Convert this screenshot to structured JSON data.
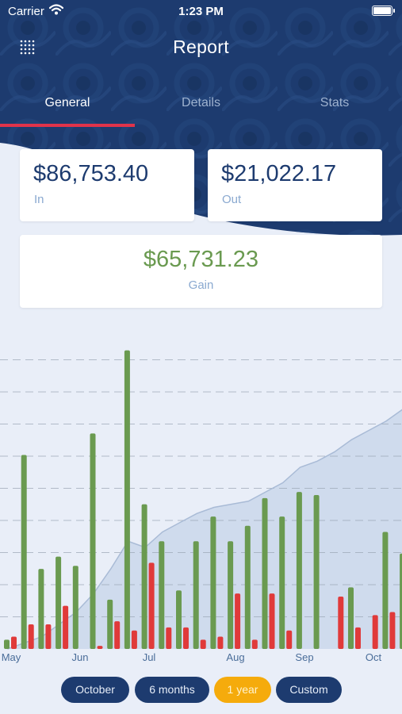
{
  "status_bar": {
    "carrier": "Carrier",
    "time": "1:23 PM"
  },
  "nav": {
    "title": "Report",
    "menu_icon": "grid-dots-icon"
  },
  "tabs": [
    {
      "label": "General",
      "active": true
    },
    {
      "label": "Details",
      "active": false
    },
    {
      "label": "Stats",
      "active": false
    }
  ],
  "summary": {
    "in": {
      "amount": "$86,753.40",
      "label": "In"
    },
    "out": {
      "amount": "$21,022.17",
      "label": "Out"
    },
    "gain": {
      "amount": "$65,731.23",
      "label": "Gain"
    }
  },
  "colors": {
    "header": "#1d3b6f",
    "income": "#6a9a50",
    "expense": "#e03a3a",
    "tab_indicator": "#e0334a",
    "selected_range": "#f5ab0c"
  },
  "chart_data": {
    "type": "bar",
    "x_labels": [
      "May",
      "Jun",
      "Jul",
      "Aug",
      "Sep",
      "Oct"
    ],
    "grid": true,
    "series": [
      {
        "values": [
          3,
          63,
          26,
          30,
          27,
          70,
          16,
          97,
          47,
          35,
          19,
          35,
          43,
          35,
          40,
          49,
          43,
          51,
          50,
          0,
          20,
          0,
          38,
          31,
          34,
          43,
          34,
          22
        ]
      },
      {
        "values": [
          4,
          8,
          8,
          14,
          0,
          1,
          9,
          6,
          28,
          7,
          7,
          3,
          4,
          18,
          3,
          18,
          6,
          0,
          0,
          17,
          7,
          11,
          12,
          2,
          0,
          0,
          1,
          2
        ]
      },
      {
        "values": [
          0,
          2,
          4,
          8,
          12,
          18,
          26,
          35,
          33,
          38,
          41,
          44,
          46,
          47,
          48,
          51,
          54,
          59,
          61,
          64,
          68,
          71,
          74,
          78,
          81,
          85,
          88,
          91
        ]
      }
    ]
  },
  "range_buttons": [
    {
      "label": "October",
      "selected": false
    },
    {
      "label": "6 months",
      "selected": false
    },
    {
      "label": "1 year",
      "selected": true
    },
    {
      "label": "Custom",
      "selected": false
    }
  ]
}
